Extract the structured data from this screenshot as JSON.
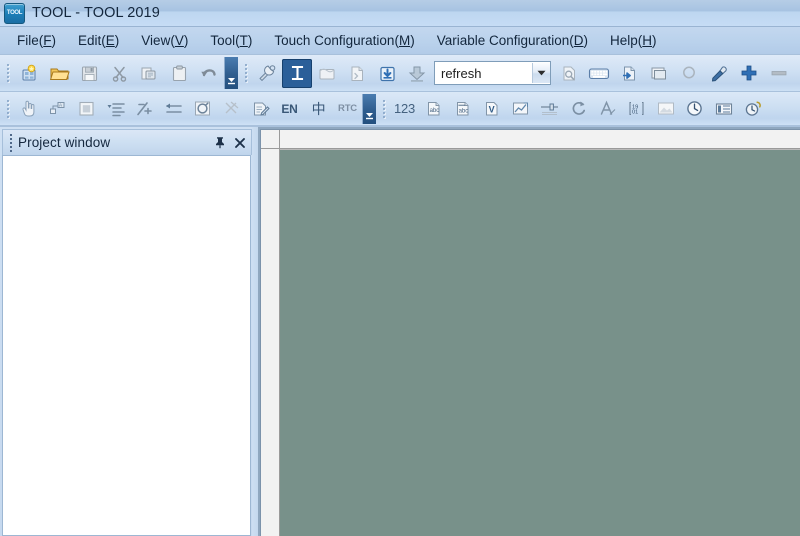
{
  "window": {
    "title": "TOOL - TOOL 2019",
    "app_icon": "app-logo-icon",
    "icon_text": "TOOL"
  },
  "menubar": {
    "items": [
      {
        "name": "file",
        "text": "File",
        "pre": "File",
        "mnemonic": "F"
      },
      {
        "name": "edit",
        "text": "Edit",
        "pre": "Edit",
        "mnemonic": "E"
      },
      {
        "name": "view",
        "text": "View",
        "pre": "View",
        "mnemonic": "V"
      },
      {
        "name": "tool",
        "text": "Tool",
        "pre": "Tool",
        "mnemonic": "T"
      },
      {
        "name": "touch-config",
        "text": "Touch Configuration",
        "pre": "Touch Configuration",
        "mnemonic": "M"
      },
      {
        "name": "variable-config",
        "text": "Variable Configuration",
        "pre": "Variable Configuration",
        "mnemonic": "D"
      },
      {
        "name": "help",
        "text": "Help",
        "pre": "Help",
        "mnemonic": "H"
      }
    ]
  },
  "toolbar_row1": {
    "group1": [
      {
        "name": "new-project-button",
        "icon": "new-project-icon",
        "enabled": true
      },
      {
        "name": "open-button",
        "icon": "open-folder-icon",
        "enabled": true
      },
      {
        "name": "save-button",
        "icon": "save-disk-icon",
        "enabled": false
      },
      {
        "name": "cut-button",
        "icon": "scissors-icon",
        "enabled": false
      },
      {
        "name": "copy-button",
        "icon": "copy-icon",
        "enabled": false
      },
      {
        "name": "paste-button",
        "icon": "paste-clipboard-icon",
        "enabled": false
      },
      {
        "name": "undo-button",
        "icon": "undo-arrow-icon",
        "enabled": true
      }
    ],
    "overflow_label": "toolbar-overflow-chevron",
    "group2": [
      {
        "name": "settings-button",
        "icon": "wrench-gear-icon",
        "enabled": true
      },
      {
        "name": "text-tool-button",
        "icon": "text-cursor-icon",
        "enabled": true,
        "selected": true
      },
      {
        "name": "screen-button",
        "icon": "screen-icon",
        "enabled": false
      },
      {
        "name": "script-button",
        "icon": "script-page-icon",
        "enabled": false
      },
      {
        "name": "download-button",
        "icon": "download-box-icon",
        "enabled": true
      },
      {
        "name": "upload-button",
        "icon": "download-arrow-icon",
        "enabled": true
      }
    ],
    "combo": {
      "name": "refresh-combo",
      "value": "refresh",
      "placeholder": "refresh",
      "options": [
        "refresh"
      ]
    },
    "group3": [
      {
        "name": "preview-button",
        "icon": "preview-page-icon",
        "enabled": false
      },
      {
        "name": "keyboard-button",
        "icon": "keyboard-icon",
        "enabled": true
      },
      {
        "name": "import-page-button",
        "icon": "import-page-icon",
        "enabled": true
      },
      {
        "name": "layers-button",
        "icon": "layers-icon",
        "enabled": true
      },
      {
        "name": "zoom-button",
        "icon": "magnifier-icon",
        "enabled": false
      },
      {
        "name": "eyedropper-button",
        "icon": "eyedropper-icon",
        "enabled": true
      },
      {
        "name": "add-button",
        "icon": "plus-icon",
        "enabled": true
      },
      {
        "name": "remove-button",
        "icon": "minus-icon",
        "enabled": false
      }
    ]
  },
  "toolbar_row2": {
    "group1": [
      {
        "name": "select-hand-button",
        "icon": "pointing-hand-icon",
        "enabled": true
      },
      {
        "name": "group-button",
        "icon": "group-nodes-icon",
        "enabled": true
      },
      {
        "name": "fill-button",
        "icon": "filled-square-icon",
        "enabled": false
      },
      {
        "name": "align-list-button",
        "icon": "align-list-icon",
        "enabled": true
      },
      {
        "name": "distribute-button",
        "icon": "distribute-icon",
        "enabled": true
      },
      {
        "name": "align-center-button",
        "icon": "align-center-icon",
        "enabled": true
      },
      {
        "name": "rotate-button",
        "icon": "rotate-circle-icon",
        "enabled": true
      },
      {
        "name": "cut-link-button",
        "icon": "cut-link-icon",
        "enabled": false
      },
      {
        "name": "edit-doc-button",
        "icon": "edit-document-icon",
        "enabled": true
      }
    ],
    "lang": [
      {
        "name": "lang-en-button",
        "label": "EN",
        "style": "bold",
        "enabled": true
      },
      {
        "name": "lang-cn-button",
        "label": "中",
        "style": "cn",
        "enabled": true
      },
      {
        "name": "rtc-button",
        "label": "RTC",
        "style": "dim",
        "enabled": true
      }
    ],
    "overflow_label": "toolbar-overflow-chevron",
    "group2": [
      {
        "name": "number-field-button",
        "label": "123",
        "icon": "number-123-icon",
        "enabled": true
      },
      {
        "name": "text-field-button",
        "icon": "abc-page-icon",
        "enabled": true
      },
      {
        "name": "text-field2-button",
        "icon": "abc-page-alt-icon",
        "enabled": true
      },
      {
        "name": "variable-button",
        "icon": "v-page-icon",
        "enabled": true
      },
      {
        "name": "chart-button",
        "icon": "trend-chart-icon",
        "enabled": true
      },
      {
        "name": "slider-button",
        "icon": "slider-icon",
        "enabled": true
      },
      {
        "name": "loop-button",
        "icon": "loop-arrow-icon",
        "enabled": true
      },
      {
        "name": "font-button",
        "icon": "font-a-icon",
        "enabled": true
      },
      {
        "name": "counter-button",
        "icon": "counter-digits-icon",
        "enabled": true
      },
      {
        "name": "image-button",
        "icon": "image-icon",
        "enabled": false
      },
      {
        "name": "clock-button",
        "icon": "clock-icon",
        "enabled": true
      },
      {
        "name": "bar-meter-button",
        "icon": "bar-meter-icon",
        "enabled": true
      },
      {
        "name": "alarm-button",
        "icon": "alarm-clock-icon",
        "enabled": true
      }
    ]
  },
  "project_panel": {
    "title": "Project window",
    "pin_icon": "pin-icon",
    "close_icon": "close-icon",
    "content": ""
  },
  "colors": {
    "title_bar": "#b6cde6",
    "menu_bar": "#bad2ec",
    "toolbar": "#cfe0f3",
    "canvas": "#78918a",
    "panel_bg": "#ffffff",
    "accent_selected": "#2b5f99",
    "plus_blue": "#2f6fb5"
  }
}
